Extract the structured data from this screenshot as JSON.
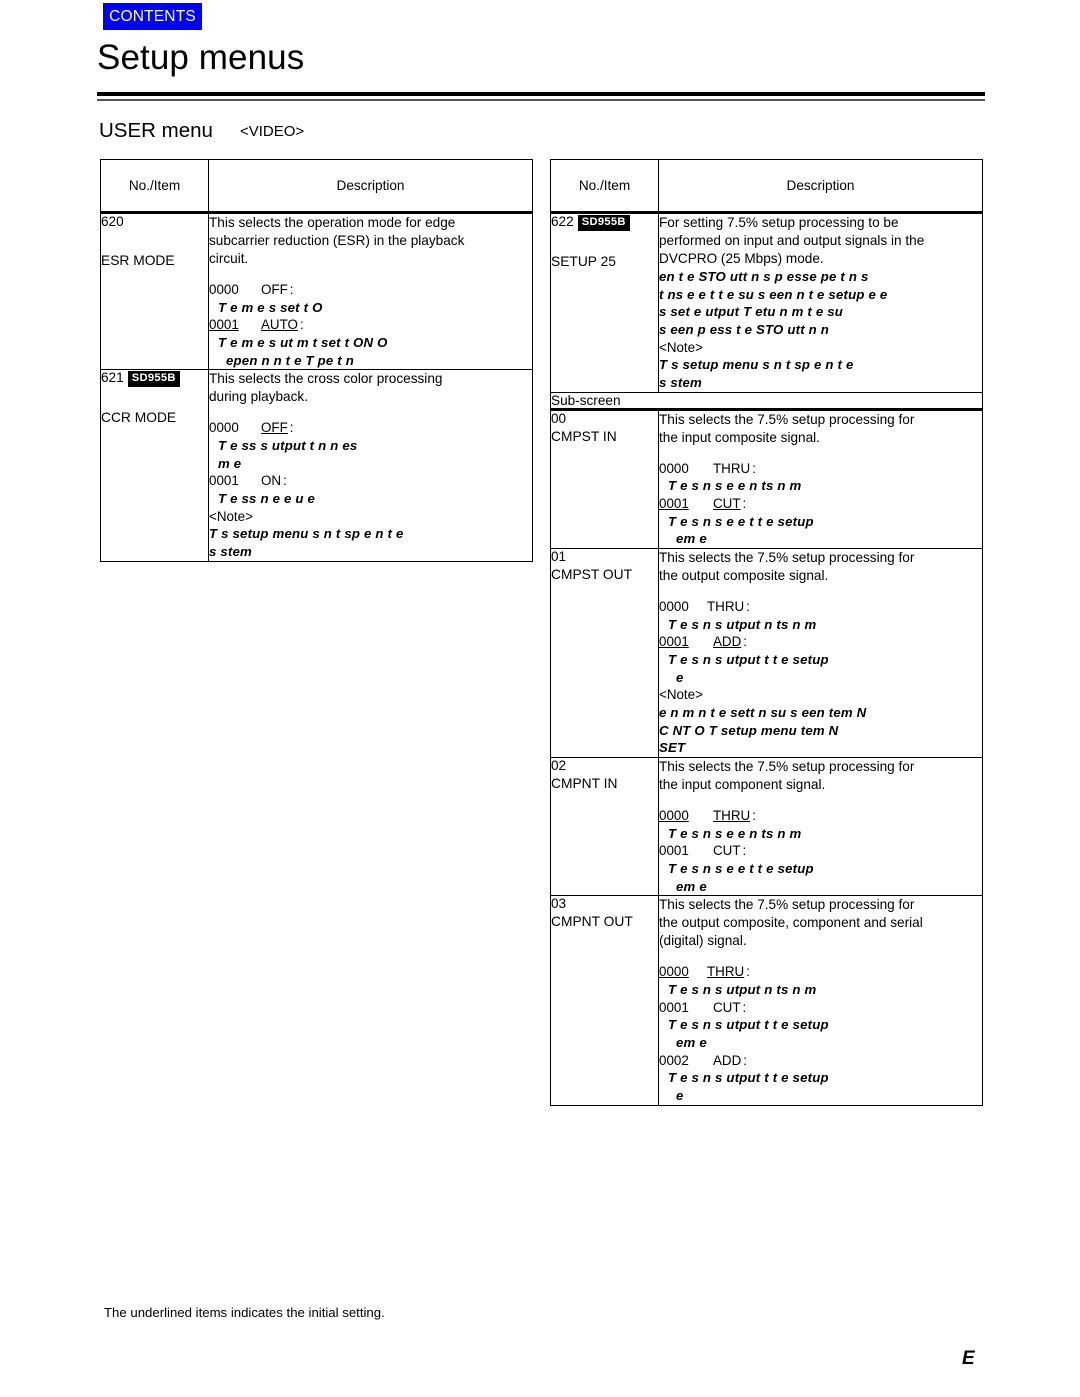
{
  "header": {
    "contents_tab": "CONTENTS",
    "title": "Setup menus",
    "section": "USER menu",
    "section_sub": "<VIDEO>"
  },
  "columns": {
    "no_item": "No./Item",
    "description": "Description"
  },
  "labels": {
    "note": "<Note>",
    "sub_screen": "Sub-screen",
    "badge_sd955b": "SD955B"
  },
  "left_table": {
    "rows": [
      {
        "no": "620",
        "badge": "",
        "item": "ESR MODE",
        "desc_lines": [
          "This selects the operation mode for edge",
          "subcarrier reduction (ESR) in the playback",
          "circuit."
        ],
        "options": [
          {
            "code": "0000",
            "code_underline": false,
            "value": "OFF",
            "value_underline": false,
            "detail": [
              "T e m    e s              set t  O"
            ]
          },
          {
            "code": "0001",
            "code_underline": true,
            "value": "AUTO",
            "value_underline": true,
            "detail": [
              "T e m   e s  ut m t        set t  ON   O",
              " epen n  n t e  T   pe t n"
            ]
          }
        ]
      },
      {
        "no": "621",
        "badge": "SD955B",
        "item": "CCR MODE",
        "desc_lines": [
          "This selects the cross color processing",
          "during playback."
        ],
        "options": [
          {
            "code": "0000",
            "code_underline": false,
            "value": "OFF",
            "value_underline": true,
            "detail": [
              "T e     ss             s  utput    t n         n  es",
              " m   e"
            ]
          },
          {
            "code": "0001",
            "code_underline": false,
            "value": "ON",
            "value_underline": false,
            "detail": [
              "T e     ss           n  e e u e"
            ]
          }
        ],
        "note_lines": [
          "T  s setup menu  s n t   sp   e   n t e",
          "s stem"
        ]
      }
    ]
  },
  "right_table": {
    "rows": [
      {
        "no": "622",
        "badge": "SD955B",
        "item": "SETUP 25",
        "desc_lines": [
          "For setting 7.5% setup processing to be",
          "performed on input and output signals in the",
          "DVCPRO (25 Mbps) mode."
        ],
        "broken_lines": [
          "   en t e STO    utt n s p esse    pe t n s",
          "t ns e e  t  t e su  s  een  n t e setup e e",
          " s set    e        utput  T  etu n    m t e su",
          "s  een p ess t e STO    utt n      n"
        ],
        "note_lines": [
          "T  s setup menu  s n t   sp   e   n t e",
          "s stem"
        ]
      }
    ],
    "sub_screen_label": "Sub-screen",
    "sub_rows": [
      {
        "no": "00",
        "item": "CMPST IN",
        "desc_lines": [
          "This selects the 7.5% setup processing for",
          "the input composite signal."
        ],
        "options": [
          {
            "code": "0000",
            "code_underline": false,
            "value": "THRU",
            "value_underline": false,
            "detail": [
              "T  e s  n    s e      e  n ts     n     m"
            ]
          },
          {
            "code": "0001",
            "code_underline": true,
            "value": "CUT",
            "value_underline": true,
            "detail": [
              "T  e s  n    s e     e    t  t e        setup",
              " em   e"
            ]
          }
        ]
      },
      {
        "no": "01",
        "item": "CMPST OUT",
        "desc_lines": [
          "This selects the 7.5% setup processing for",
          "the output composite signal."
        ],
        "options": [
          {
            "code": "0000",
            "code_underline": false,
            "value": "THRU",
            "value_underline": false,
            "detail": [
              "T  e s  n   s  utput n ts     n      m"
            ]
          },
          {
            "code": "0001",
            "code_underline": true,
            "value": "ADD",
            "value_underline": true,
            "detail": [
              "T  e s  n   s   utput    t  t e         setup",
              "    e"
            ]
          }
        ],
        "note_lines": [
          " e   n m n  t e sett n       su  s  een  tem N",
          "  C   NT O T    setup menu  tem N",
          "SET"
        ]
      },
      {
        "no": "02",
        "item": "CMPNT IN",
        "desc_lines": [
          "This selects the 7.5% setup processing for",
          "the input component signal."
        ],
        "options": [
          {
            "code": "0000",
            "code_underline": true,
            "value": "THRU",
            "value_underline": true,
            "detail": [
              "T  e s  n    s e      e  n ts     n     m"
            ]
          },
          {
            "code": "0001",
            "code_underline": false,
            "value": "CUT",
            "value_underline": false,
            "detail": [
              "T  e s  n    s e     e    t  t e        setup",
              " em   e"
            ]
          }
        ]
      },
      {
        "no": "03",
        "item": "CMPNT OUT",
        "desc_lines": [
          "This selects the 7.5% setup processing for",
          "the output composite, component and serial",
          "(digital) signal."
        ],
        "options": [
          {
            "code": "0000",
            "code_underline": true,
            "value": "THRU",
            "value_underline": true,
            "detail": [
              "T  e s  n   s  utput n ts     n      m"
            ]
          },
          {
            "code": "0001",
            "code_underline": false,
            "value": "CUT",
            "value_underline": false,
            "detail": [
              "T  e s  n   s   utput    t  t e        setup",
              " em   e"
            ]
          },
          {
            "code": "0002",
            "code_underline": false,
            "value": "ADD",
            "value_underline": false,
            "detail": [
              "T  e s  n   s   utput    t  t e        setup",
              "    e"
            ]
          }
        ]
      }
    ]
  },
  "footer": {
    "footnote": "The underlined items indicates the initial setting.",
    "page_mark": "E"
  }
}
